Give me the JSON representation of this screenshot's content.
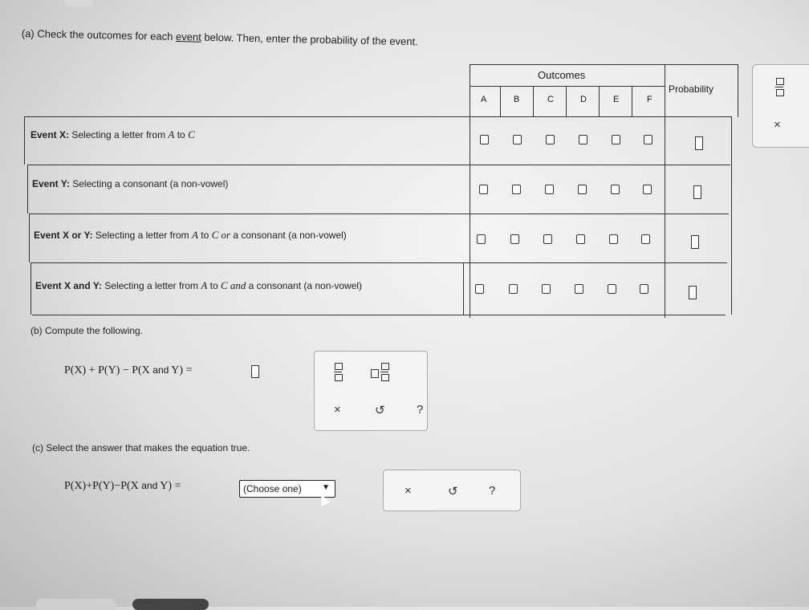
{
  "instructions": {
    "part_a_pre": "(a) Check the outcomes for each ",
    "part_a_link": "event",
    "part_a_post": " below. Then, enter the probability of the event."
  },
  "table": {
    "outcomes_header": "Outcomes",
    "probability_header": "Probability",
    "letters": [
      "A",
      "B",
      "C",
      "D",
      "E",
      "F"
    ],
    "events": [
      {
        "name": "Event X:",
        "desc1": "Selecting a letter from ",
        "v1": "A",
        "desc2": " to ",
        "v2": "C",
        "desc3": "",
        "desc4": ""
      },
      {
        "name": "Event Y:",
        "desc1": "Selecting a consonant (a non-vowel)",
        "v1": "",
        "desc2": "",
        "v2": "",
        "desc3": "",
        "desc4": ""
      },
      {
        "name": "Event X or Y:",
        "desc1": "Selecting a letter from ",
        "v1": "A",
        "desc2": " to ",
        "v2": "C",
        "desc3": " or ",
        "desc4": "a consonant (a non-vowel)"
      },
      {
        "name": "Event X and Y:",
        "desc1": "Selecting a letter from ",
        "v1": "A",
        "desc2": " to ",
        "v2": "C",
        "desc3": " and ",
        "desc4": "a consonant (a non-vowel)"
      }
    ]
  },
  "part_b": {
    "label": "(b) Compute the following.",
    "formula_left": "P(X) + P(Y) − P(X ",
    "formula_and": "and",
    "formula_right": " Y) ="
  },
  "part_c": {
    "label": "(c) Select the answer that makes the equation true.",
    "formula_left": "P(X)+P(Y)−P(X ",
    "formula_and": "and",
    "formula_right": " Y) =",
    "select_value": "(Choose one)"
  },
  "tools": {
    "clear": "×",
    "undo": "↺",
    "help": "?"
  }
}
